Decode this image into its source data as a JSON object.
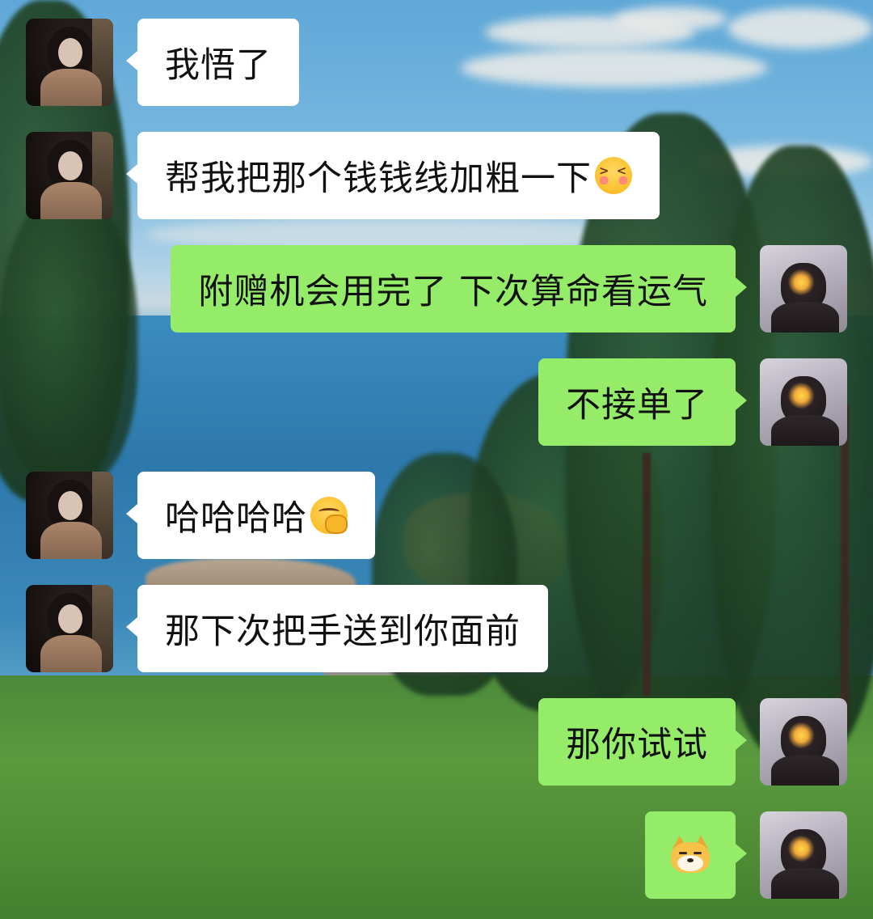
{
  "background": {
    "description_icon": "seaside-landscape-background"
  },
  "colors": {
    "incoming_bubble": "#ffffff",
    "outgoing_bubble": "#95ec69",
    "text": "#111111"
  },
  "messages": [
    {
      "side": "left",
      "sender": "her",
      "text": "我悟了",
      "emoji": ""
    },
    {
      "side": "left",
      "sender": "her",
      "text": "帮我把那个钱钱线加粗一下",
      "emoji": "shy-face-emoji"
    },
    {
      "side": "right",
      "sender": "me",
      "text": "附赠机会用完了 下次算命看运气",
      "emoji": ""
    },
    {
      "side": "right",
      "sender": "me",
      "text": "不接单了",
      "emoji": ""
    },
    {
      "side": "left",
      "sender": "her",
      "text": "哈哈哈哈",
      "emoji": "hand-over-mouth-emoji"
    },
    {
      "side": "left",
      "sender": "her",
      "text": "那下次把手送到你面前",
      "emoji": ""
    },
    {
      "side": "right",
      "sender": "me",
      "text": "那你试试",
      "emoji": ""
    },
    {
      "side": "right",
      "sender": "me",
      "text": "",
      "emoji": "doge-emoji"
    }
  ]
}
